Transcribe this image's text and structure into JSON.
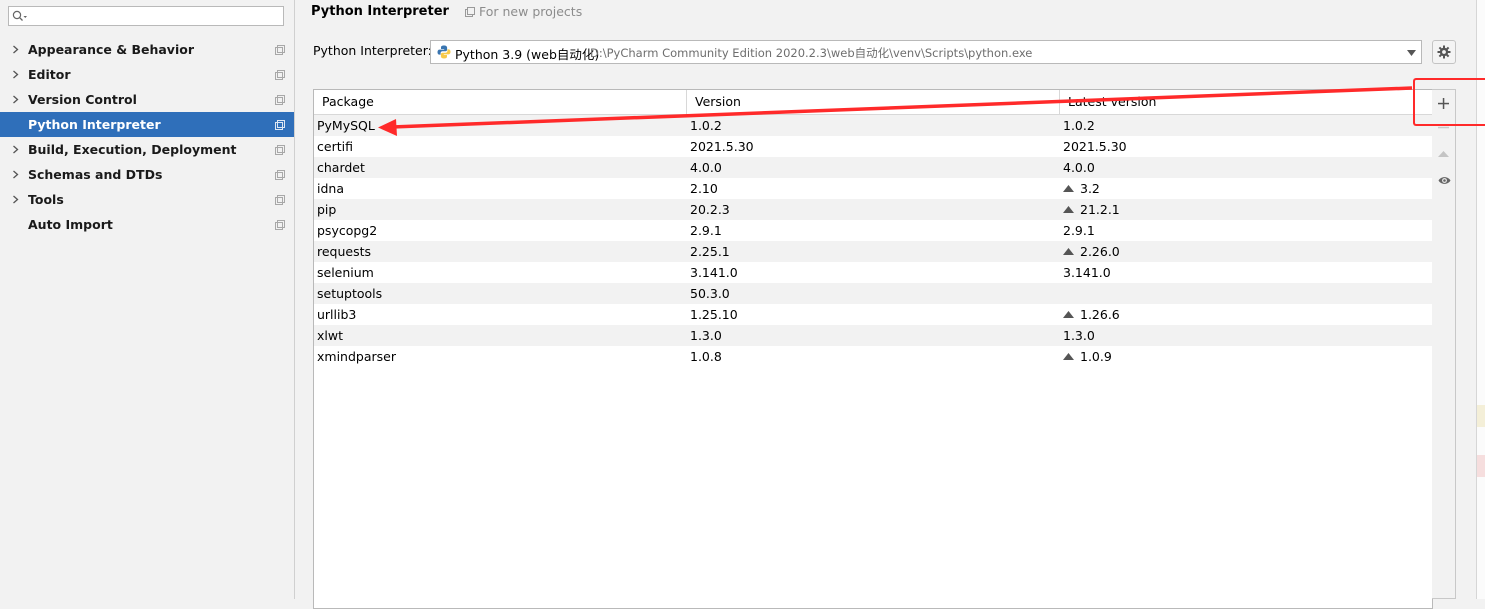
{
  "sidebar": {
    "search_placeholder": "",
    "items": [
      {
        "label": "Appearance & Behavior",
        "expandable": true,
        "selected": false
      },
      {
        "label": "Editor",
        "expandable": true,
        "selected": false
      },
      {
        "label": "Version Control",
        "expandable": true,
        "selected": false
      },
      {
        "label": "Python Interpreter",
        "expandable": false,
        "selected": true
      },
      {
        "label": "Build, Execution, Deployment",
        "expandable": true,
        "selected": false
      },
      {
        "label": "Schemas and DTDs",
        "expandable": true,
        "selected": false
      },
      {
        "label": "Tools",
        "expandable": true,
        "selected": false
      },
      {
        "label": "Auto Import",
        "expandable": false,
        "selected": false
      }
    ]
  },
  "header": {
    "title": "Python Interpreter",
    "for_new_projects": "For new projects"
  },
  "interpreter": {
    "label": "Python Interpreter:",
    "name": "Python 3.9 (web自动化)",
    "path": "D:\\PyCharm Community Edition 2020.2.3\\web自动化\\venv\\Scripts\\python.exe"
  },
  "table": {
    "columns": [
      "Package",
      "Version",
      "Latest version"
    ],
    "rows": [
      {
        "package": "PyMySQL",
        "version": "1.0.2",
        "latest": "1.0.2",
        "upgrade": false
      },
      {
        "package": "certifi",
        "version": "2021.5.30",
        "latest": "2021.5.30",
        "upgrade": false
      },
      {
        "package": "chardet",
        "version": "4.0.0",
        "latest": "4.0.0",
        "upgrade": false
      },
      {
        "package": "idna",
        "version": "2.10",
        "latest": "3.2",
        "upgrade": true
      },
      {
        "package": "pip",
        "version": "20.2.3",
        "latest": "21.2.1",
        "upgrade": true
      },
      {
        "package": "psycopg2",
        "version": "2.9.1",
        "latest": "2.9.1",
        "upgrade": false
      },
      {
        "package": "requests",
        "version": "2.25.1",
        "latest": "2.26.0",
        "upgrade": true
      },
      {
        "package": "selenium",
        "version": "3.141.0",
        "latest": "3.141.0",
        "upgrade": false
      },
      {
        "package": "setuptools",
        "version": "50.3.0",
        "latest": "",
        "upgrade": false
      },
      {
        "package": "urllib3",
        "version": "1.25.10",
        "latest": "1.26.6",
        "upgrade": true
      },
      {
        "package": "xlwt",
        "version": "1.3.0",
        "latest": "1.3.0",
        "upgrade": false
      },
      {
        "package": "xmindparser",
        "version": "1.0.8",
        "latest": "1.0.9",
        "upgrade": true
      }
    ]
  },
  "tools": {
    "icons": [
      "plus-icon",
      "minus-icon",
      "upgrade-icon",
      "eye-icon"
    ]
  },
  "colors": {
    "selection": "#2f6fba",
    "annotation": "#ff2a2a",
    "row_alt": "#f2f2f2"
  }
}
